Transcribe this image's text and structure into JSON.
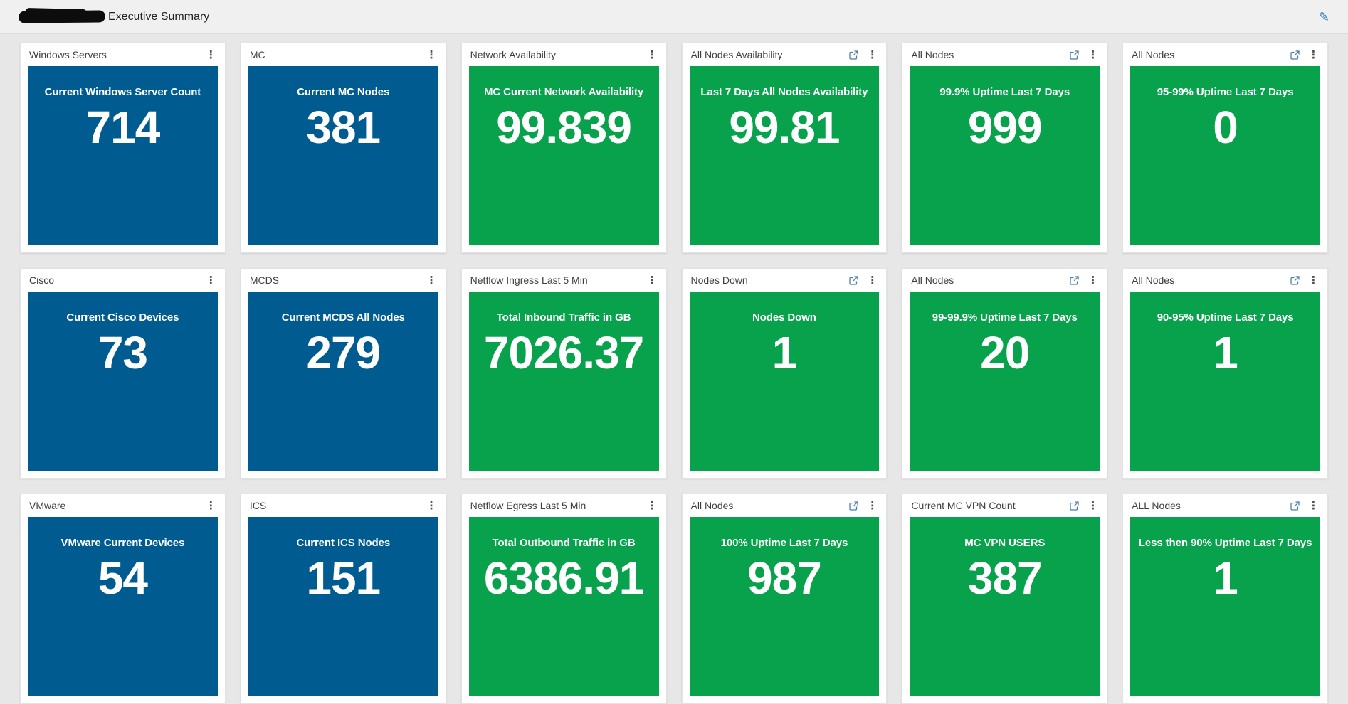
{
  "header": {
    "title": "Executive Summary",
    "title_prefix_redacted": true
  },
  "icons": {
    "kebab_menu_glyph": "⋮",
    "edit_pencil_glyph": "✎",
    "external_link": "open-in-new-window"
  },
  "colors": {
    "blue": "#005C90",
    "green": "#07A24B",
    "icon_blue": "#4d7ea8"
  },
  "cards": [
    {
      "title": "Windows Servers",
      "label": "Current Windows Server Count",
      "value": "714",
      "color": "blue",
      "external": false
    },
    {
      "title": "MC",
      "label": "Current MC Nodes",
      "value": "381",
      "color": "blue",
      "external": false
    },
    {
      "title": "Network Availability",
      "label": "MC Current Network Availability",
      "value": "99.839",
      "color": "green",
      "external": false
    },
    {
      "title": "All Nodes Availability",
      "label": "Last 7 Days All Nodes Availability",
      "value": "99.81",
      "color": "green",
      "external": true
    },
    {
      "title": "All Nodes",
      "label": "99.9% Uptime Last 7 Days",
      "value": "999",
      "color": "green",
      "external": true
    },
    {
      "title": "All Nodes",
      "label": "95-99% Uptime Last 7 Days",
      "value": "0",
      "color": "green",
      "external": true
    },
    {
      "title": "Cisco",
      "label": "Current Cisco Devices",
      "value": "73",
      "color": "blue",
      "external": false
    },
    {
      "title": "MCDS",
      "label": "Current MCDS All Nodes",
      "value": "279",
      "color": "blue",
      "external": false
    },
    {
      "title": "Netflow Ingress Last 5 Min",
      "label": "Total Inbound Traffic in GB",
      "value": "7026.37",
      "color": "green",
      "external": false
    },
    {
      "title": "Nodes Down",
      "label": "Nodes Down",
      "value": "1",
      "color": "green",
      "external": true
    },
    {
      "title": "All Nodes",
      "label": "99-99.9% Uptime Last 7 Days",
      "value": "20",
      "color": "green",
      "external": true
    },
    {
      "title": "All Nodes",
      "label": "90-95% Uptime Last 7 Days",
      "value": "1",
      "color": "green",
      "external": true
    },
    {
      "title": "VMware",
      "label": "VMware Current Devices",
      "value": "54",
      "color": "blue",
      "external": false
    },
    {
      "title": "ICS",
      "label": "Current ICS Nodes",
      "value": "151",
      "color": "blue",
      "external": false
    },
    {
      "title": "Netflow Egress Last 5 Min",
      "label": "Total Outbound Traffic in GB",
      "value": "6386.91",
      "color": "green",
      "external": false
    },
    {
      "title": "All Nodes",
      "label": "100% Uptime Last 7 Days",
      "value": "987",
      "color": "green",
      "external": true
    },
    {
      "title": "Current MC VPN Count",
      "label": "MC VPN USERS",
      "value": "387",
      "color": "green",
      "external": true
    },
    {
      "title": "ALL Nodes",
      "label": "Less then 90% Uptime Last 7 Days",
      "value": "1",
      "color": "green",
      "external": true
    }
  ]
}
